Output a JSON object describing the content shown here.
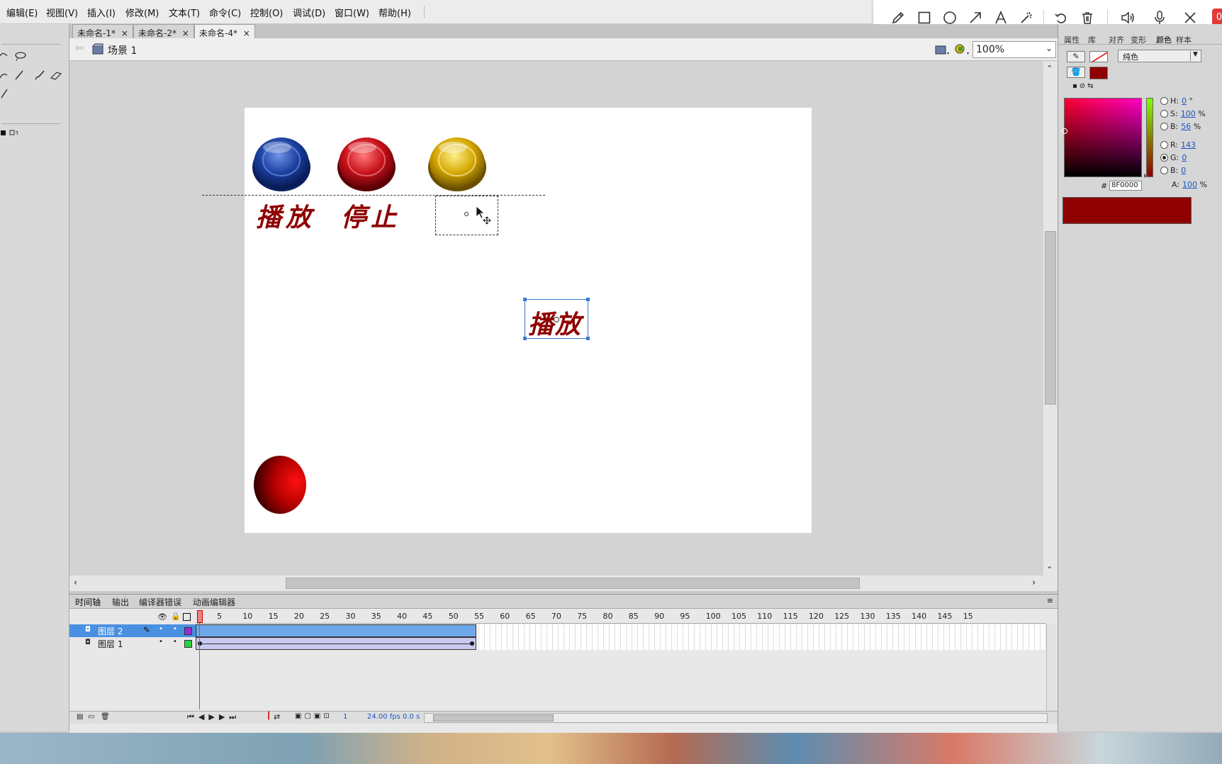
{
  "menubar": {
    "items": [
      "编辑(E)",
      "视图(V)",
      "插入(I)",
      "修改(M)",
      "文本(T)",
      "命令(C)",
      "控制(O)",
      "调试(D)",
      "窗口(W)",
      "帮助(H)"
    ]
  },
  "draw_toolbar": {
    "icons": [
      "pencil-icon",
      "rectangle-icon",
      "ellipse-icon",
      "arrow-icon",
      "text-icon",
      "magic-wand-icon",
      "undo-icon",
      "delete-icon",
      "speaker-icon",
      "microphone-icon",
      "close-icon"
    ],
    "badge": "0"
  },
  "doc_tabs": [
    {
      "label": "未命名-1*",
      "close": "×"
    },
    {
      "label": "未命名-2*",
      "close": "×"
    },
    {
      "label": "未命名-4*",
      "close": "×",
      "active": true
    }
  ],
  "editbar": {
    "scene_label": "场景 1",
    "zoom": "100%"
  },
  "stage": {
    "buttons": [
      {
        "name": "blue-button",
        "color": "#1b3f9e"
      },
      {
        "name": "red-button",
        "color": "#c8101a"
      },
      {
        "name": "yellow-button",
        "color": "#d4a600"
      }
    ],
    "labels": {
      "play": "播放",
      "stop": "停止",
      "selected_text": "播放"
    },
    "label_color": "#8f0000",
    "ball_color": "#e00000"
  },
  "timeline": {
    "tabs": [
      "时间轴",
      "输出",
      "编译器错误",
      "动画编辑器"
    ],
    "frame_numbers": [
      "1",
      "5",
      "10",
      "15",
      "20",
      "25",
      "30",
      "35",
      "40",
      "45",
      "50",
      "55",
      "60",
      "65",
      "70",
      "75",
      "80",
      "85",
      "90",
      "95",
      "100",
      "105",
      "110",
      "115",
      "120",
      "125",
      "130",
      "135",
      "140",
      "145",
      "15"
    ],
    "layers": [
      {
        "name": "图层 2",
        "selected": true,
        "swatch": "#9a2bd0"
      },
      {
        "name": "图层 1",
        "selected": false,
        "swatch": "#2bd040"
      }
    ],
    "status": {
      "frame": "1",
      "fps": "24.00 fps",
      "time": "0.0 s"
    }
  },
  "right_panel": {
    "tabs": [
      "属性",
      "库",
      "对齐",
      "变形",
      "颜色",
      "样本"
    ],
    "fill_type": "纯色",
    "hsb": {
      "h_label": "H:",
      "h_value": "0",
      "h_unit": "°",
      "s_label": "S:",
      "s_value": "100",
      "s_unit": "%",
      "b_label": "B:",
      "b_value": "56",
      "b_unit": "%"
    },
    "rgb": {
      "r_label": "R:",
      "r_value": "143",
      "g_label": "G:",
      "g_value": "0",
      "b_label": "B:",
      "b_value": "0"
    },
    "alpha_label": "A:",
    "alpha_value": "100",
    "alpha_unit": "%",
    "hex_prefix": "#",
    "hex": "8F0000",
    "current_color": "#8f0000"
  }
}
